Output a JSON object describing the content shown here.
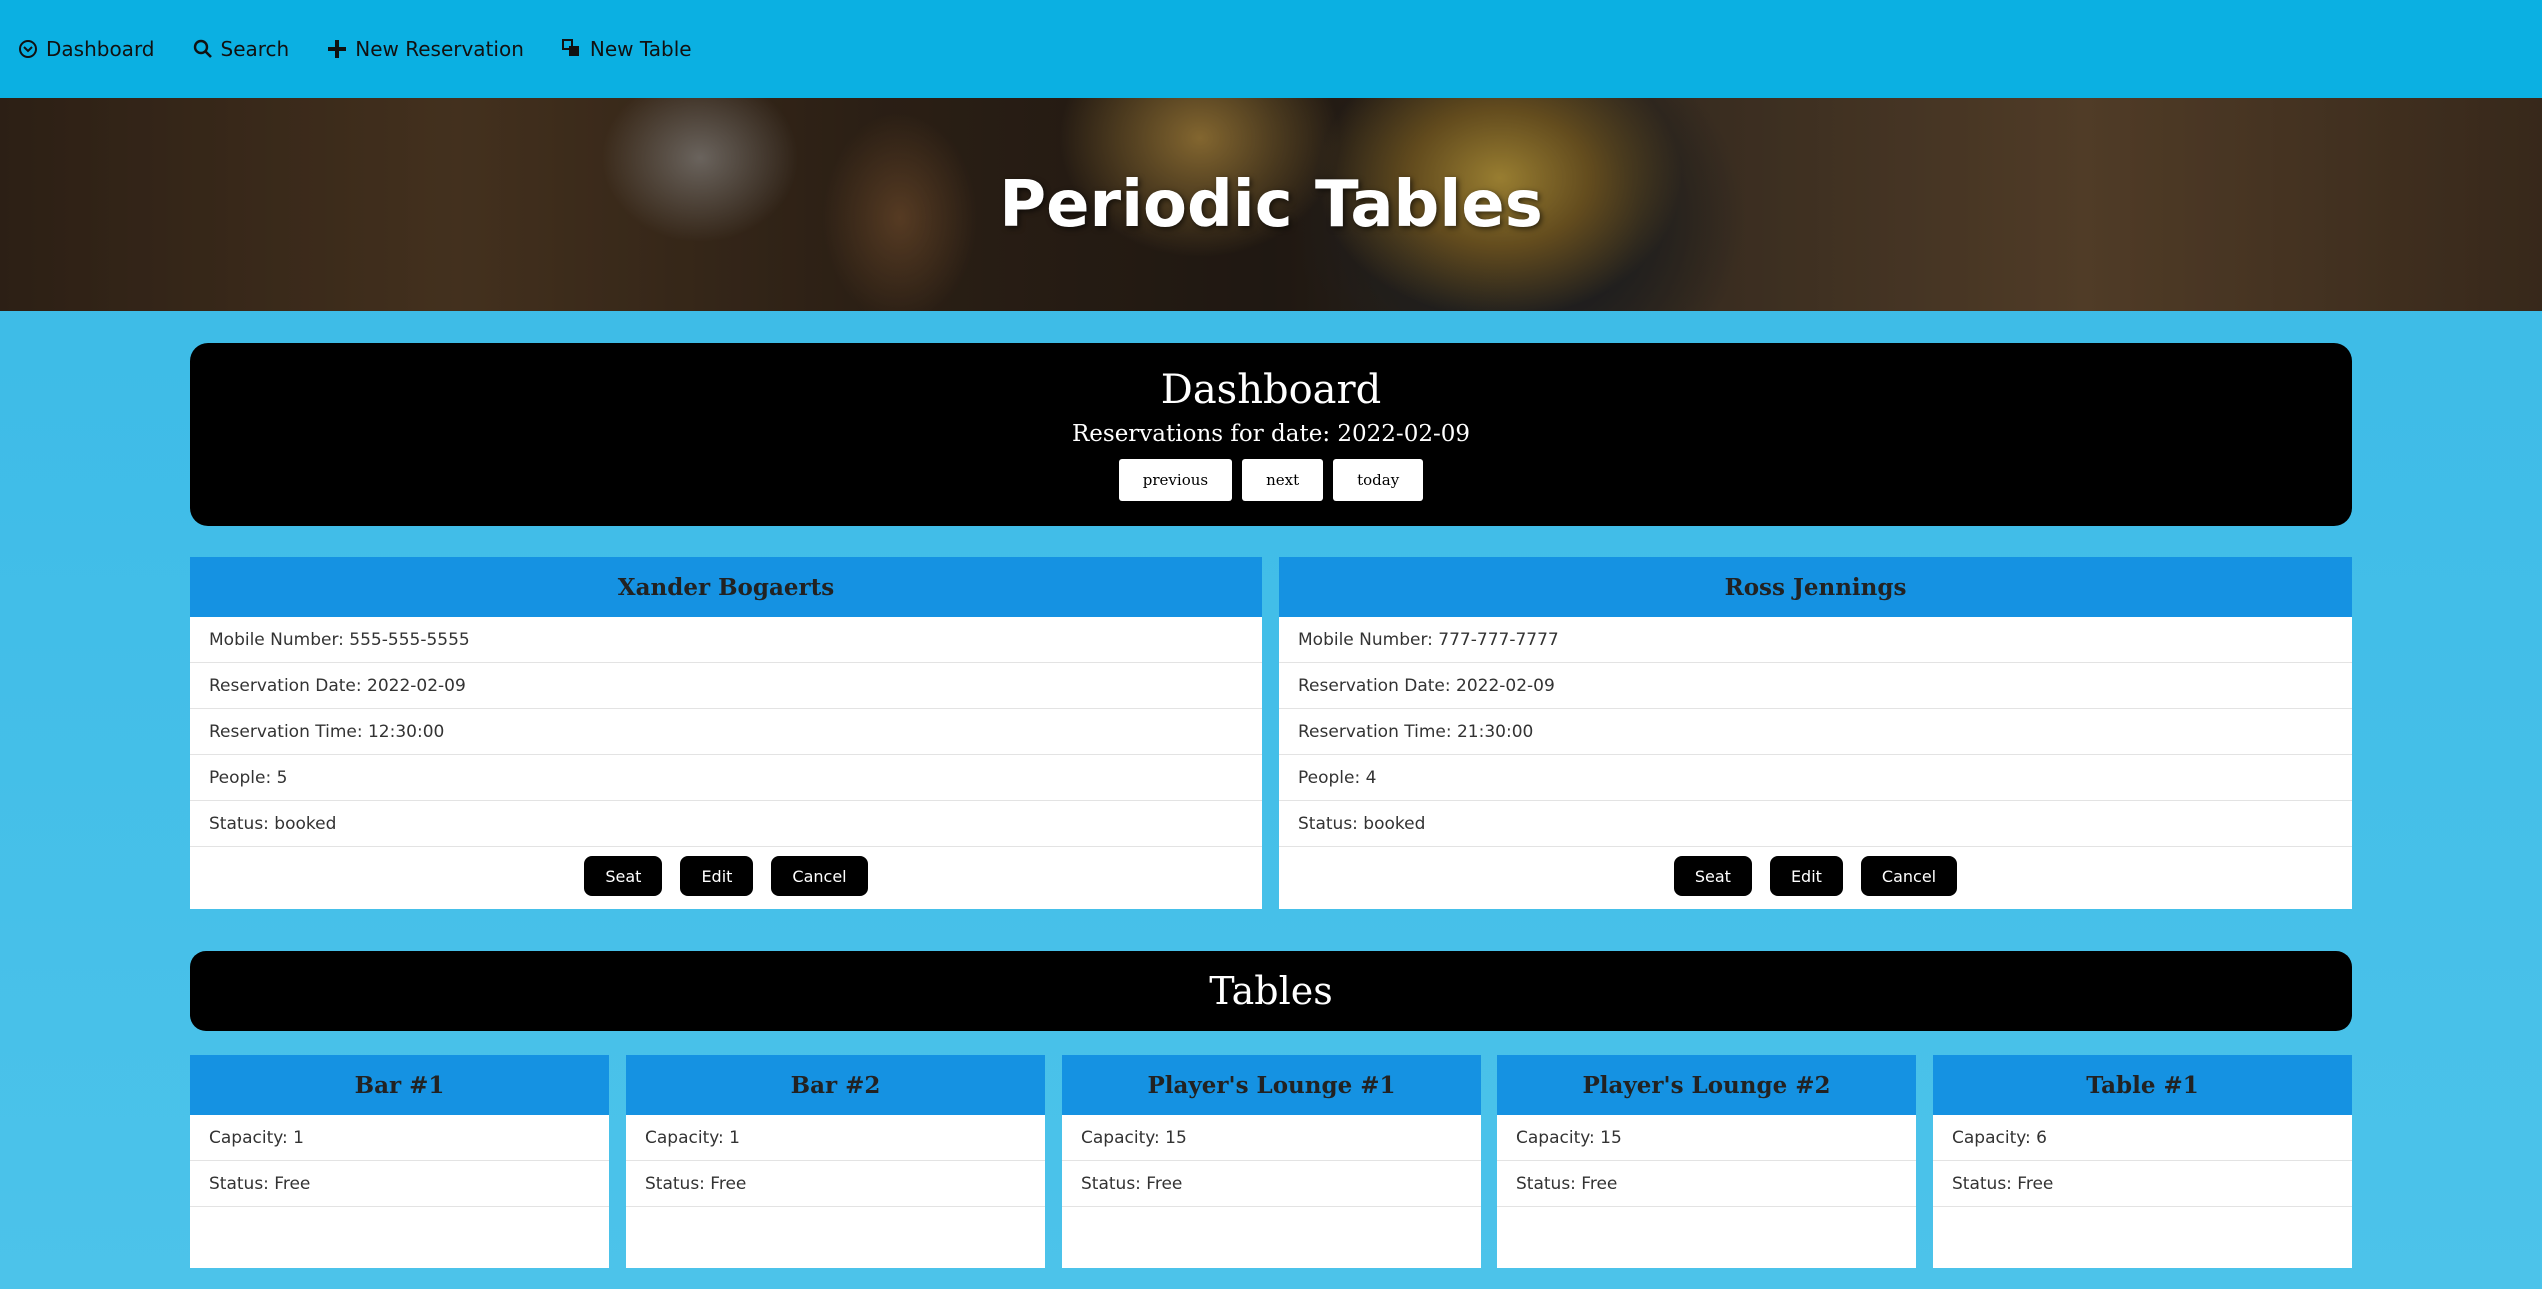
{
  "nav": {
    "items": [
      {
        "label": "Dashboard",
        "icon": "dashboard-icon"
      },
      {
        "label": "Search",
        "icon": "search-icon"
      },
      {
        "label": "New Reservation",
        "icon": "plus-icon"
      },
      {
        "label": "New Table",
        "icon": "new-table-icon"
      }
    ]
  },
  "hero": {
    "title": "Periodic Tables"
  },
  "dashboard": {
    "title": "Dashboard",
    "date_text": "Reservations for date: 2022-02-09",
    "buttons": {
      "previous": "previous",
      "next": "next",
      "today": "today"
    }
  },
  "reservations": [
    {
      "name": "Xander Bogaerts",
      "mobile": "Mobile Number: 555-555-5555",
      "date": "Reservation Date: 2022-02-09",
      "time": "Reservation Time: 12:30:00",
      "people": "People: 5",
      "status": "Status: booked",
      "actions": {
        "seat": "Seat",
        "edit": "Edit",
        "cancel": "Cancel"
      }
    },
    {
      "name": "Ross Jennings",
      "mobile": "Mobile Number: 777-777-7777",
      "date": "Reservation Date: 2022-02-09",
      "time": "Reservation Time: 21:30:00",
      "people": "People: 4",
      "status": "Status: booked",
      "actions": {
        "seat": "Seat",
        "edit": "Edit",
        "cancel": "Cancel"
      }
    }
  ],
  "tables_section": {
    "title": "Tables"
  },
  "tables": [
    {
      "name": "Bar #1",
      "capacity": "Capacity: 1",
      "status": "Status: Free"
    },
    {
      "name": "Bar #2",
      "capacity": "Capacity: 1",
      "status": "Status: Free"
    },
    {
      "name": "Player's Lounge #1",
      "capacity": "Capacity: 15",
      "status": "Status: Free"
    },
    {
      "name": "Player's Lounge #2",
      "capacity": "Capacity: 15",
      "status": "Status: Free"
    },
    {
      "name": "Table #1",
      "capacity": "Capacity: 6",
      "status": "Status: Free"
    }
  ],
  "colors": {
    "navbar": "#0bb0e2",
    "background": "#39b9e6",
    "card_header": "#1592e2"
  }
}
